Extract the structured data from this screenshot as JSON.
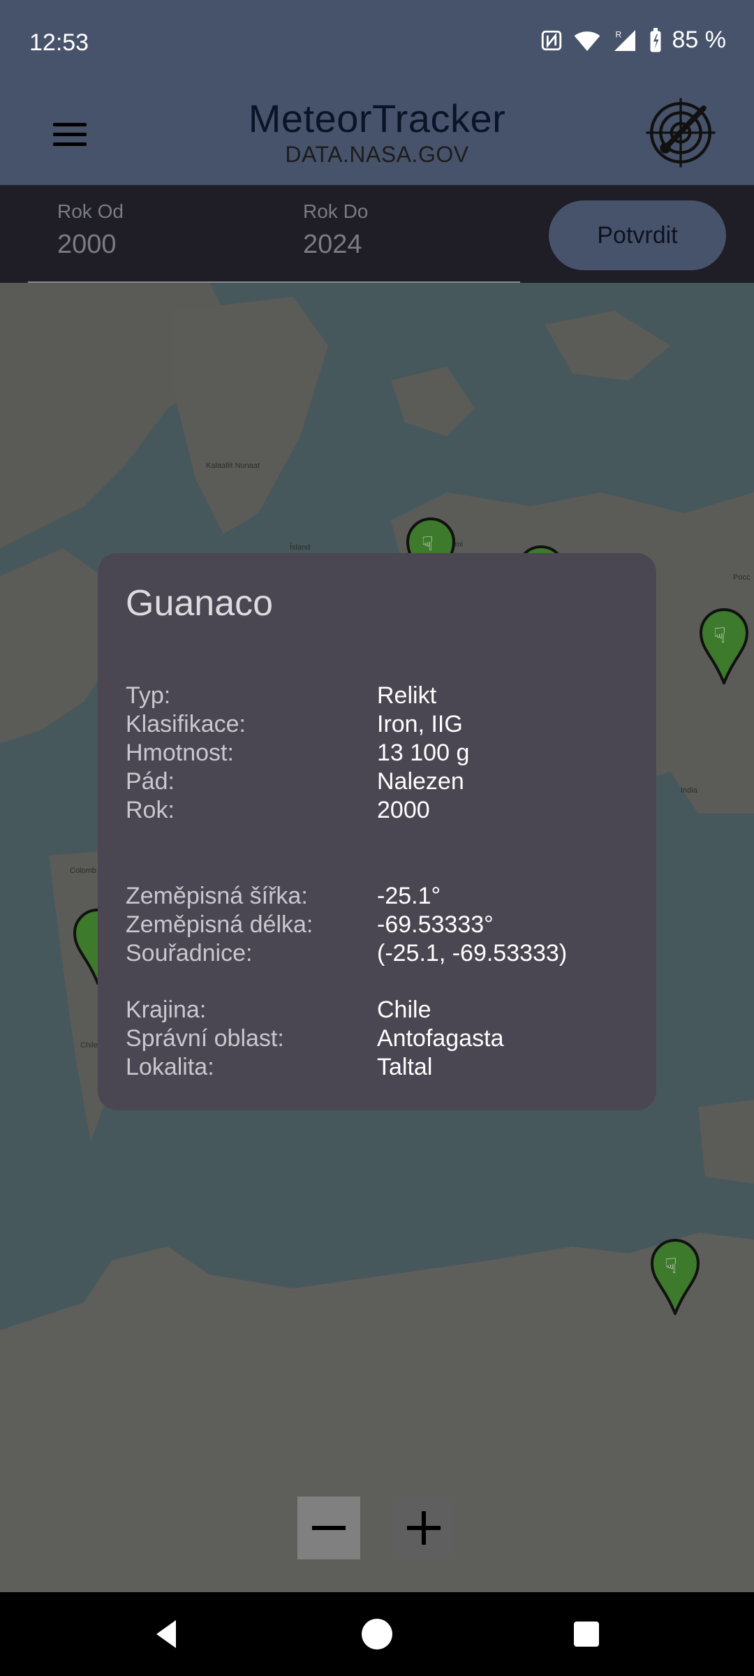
{
  "status": {
    "time": "12:53",
    "battery": "85 %",
    "icons": [
      "nfc-icon",
      "wifi-icon",
      "signal-icon",
      "battery-icon"
    ]
  },
  "app": {
    "title": "MeteorTracker",
    "subtitle": "DATA.NASA.GOV"
  },
  "filter": {
    "from_label": "Rok Od",
    "from_value": "2000",
    "to_label": "Rok Do",
    "to_value": "2024",
    "confirm_label": "Potvrdit"
  },
  "map": {
    "labels": [
      "Kalaallit Nunaat",
      "Ísland",
      "Suomi",
      "India",
      "Colomb",
      "Chile",
      "Pocc"
    ]
  },
  "dialog": {
    "title": "Guanaco",
    "rows": [
      {
        "key": "Typ:",
        "value": "Relikt"
      },
      {
        "key": "Klasifikace:",
        "value": "Iron, IIG"
      },
      {
        "key": "Hmotnost:",
        "value": "13 100 g"
      },
      {
        "key": "Pád:",
        "value": "Nalezen"
      },
      {
        "key": "Rok:",
        "value": "2000"
      },
      {
        "key": "Zeměpisná šířka:",
        "value": "-25.1°"
      },
      {
        "key": "Zeměpisná délka:",
        "value": "-69.53333°"
      },
      {
        "key": "Souřadnice:",
        "value": "(-25.1,  -69.53333)"
      },
      {
        "key": "Krajina:",
        "value": "Chile"
      },
      {
        "key": "Správní oblast:",
        "value": "Antofagasta"
      },
      {
        "key": "Lokalita:",
        "value": "Taltal"
      }
    ]
  },
  "zoom": {
    "out_icon": "minus-icon",
    "in_icon": "plus-icon"
  },
  "nav": {
    "icons": [
      "back-icon",
      "home-icon",
      "recents-icon"
    ]
  },
  "colors": {
    "appbar": "#47536b",
    "filterbar": "#1f1d25",
    "dialog": "#4a4752",
    "marker": "#3d7a2c"
  }
}
